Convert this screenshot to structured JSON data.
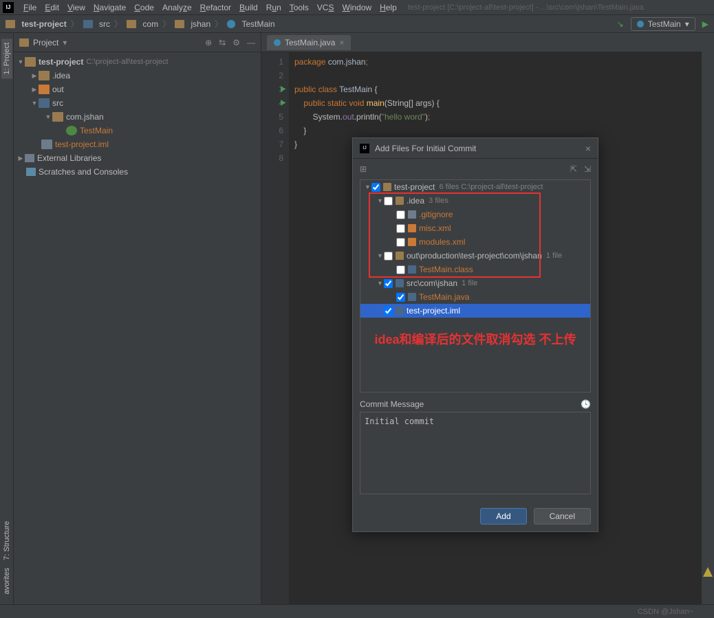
{
  "menu": {
    "items": [
      "File",
      "Edit",
      "View",
      "Navigate",
      "Code",
      "Analyze",
      "Refactor",
      "Build",
      "Run",
      "Tools",
      "VCS",
      "Window",
      "Help"
    ],
    "title_path": "test-project [C:\\project-all\\test-project] - ...\\src\\com\\jshan\\TestMain.java"
  },
  "breadcrumb": {
    "items": [
      "test-project",
      "src",
      "com",
      "jshan",
      "TestMain"
    ]
  },
  "run_config": "TestMain",
  "project_panel": {
    "title": "Project",
    "root": {
      "name": "test-project",
      "path": "C:\\project-all\\test-project"
    },
    "nodes": [
      {
        "name": ".idea",
        "indent": 2
      },
      {
        "name": "out",
        "indent": 2,
        "orange": true
      },
      {
        "name": "src",
        "indent": 2,
        "blue": true,
        "expanded": true
      },
      {
        "name": "com.jshan",
        "indent": 3,
        "expanded": true
      },
      {
        "name": "TestMain",
        "indent": 4,
        "class": true,
        "hl": true
      },
      {
        "name": "test-project.iml",
        "indent": 2,
        "file": true,
        "hl": true
      }
    ],
    "ext_lib": "External Libraries",
    "scratches": "Scratches and Consoles"
  },
  "editor": {
    "tab": "TestMain.java",
    "lines": [
      {
        "n": 1,
        "html": "<span class='kw'>package</span> <span class='pkg'>com.jshan</span><span class='semi'>;</span>"
      },
      {
        "n": 2,
        "html": ""
      },
      {
        "n": 3,
        "html": "<span class='kw'>public class</span> <span class='cls'>TestMain</span> {",
        "run": true
      },
      {
        "n": 4,
        "html": "    <span class='kw'>public static</span> <span class='kw'>void</span> <span class='fn'>main</span>(String[] args) {",
        "run": true
      },
      {
        "n": 5,
        "html": "        System.<span style='color:#9876aa'>out</span>.println(<span class='str'>\"hello word\"</span>)<span class='semi'>;</span>"
      },
      {
        "n": 6,
        "html": "    }"
      },
      {
        "n": 7,
        "html": "}"
      },
      {
        "n": 8,
        "html": ""
      }
    ]
  },
  "dialog": {
    "title": "Add Files For Initial Commit",
    "tree": [
      {
        "indent": 0,
        "arrow": "▼",
        "cb": true,
        "checked": true,
        "icon": "folder",
        "label": "test-project",
        "suffix": "6 files  C:\\project-all\\test-project"
      },
      {
        "indent": 1,
        "arrow": "▼",
        "cb": true,
        "checked": false,
        "icon": "folder",
        "label": ".idea",
        "suffix": "3 files"
      },
      {
        "indent": 2,
        "arrow": "",
        "cb": true,
        "checked": false,
        "icon": "file",
        "label": ".gitignore",
        "hl": true
      },
      {
        "indent": 2,
        "arrow": "",
        "cb": true,
        "checked": false,
        "icon": "file-o",
        "label": "misc.xml",
        "hl": true
      },
      {
        "indent": 2,
        "arrow": "",
        "cb": true,
        "checked": false,
        "icon": "file-o",
        "label": "modules.xml",
        "hl": true
      },
      {
        "indent": 1,
        "arrow": "▼",
        "cb": true,
        "checked": false,
        "icon": "folder",
        "label": "out\\production\\test-project\\com\\jshan",
        "suffix": "1 file"
      },
      {
        "indent": 2,
        "arrow": "",
        "cb": true,
        "checked": false,
        "icon": "file-b",
        "label": "TestMain.class",
        "hl": true
      },
      {
        "indent": 1,
        "arrow": "▼",
        "cb": true,
        "checked": true,
        "icon": "folder-b",
        "label": "src\\com\\jshan",
        "suffix": "1 file"
      },
      {
        "indent": 2,
        "arrow": "",
        "cb": true,
        "checked": true,
        "icon": "file-b",
        "label": "TestMain.java",
        "hl": true
      },
      {
        "indent": 1,
        "arrow": "",
        "cb": true,
        "checked": true,
        "icon": "file-b",
        "label": "test-project.iml",
        "selected": true
      }
    ],
    "annotation": "idea和编译后的文件取消勾选 不上传",
    "commit_label": "Commit Message",
    "commit_msg": "Initial commit",
    "add": "Add",
    "cancel": "Cancel"
  },
  "sidebar_tabs": {
    "project": "1: Project",
    "structure": "7: Structure",
    "favorites": "avorites"
  },
  "watermark": "CSDN @Jshan~"
}
